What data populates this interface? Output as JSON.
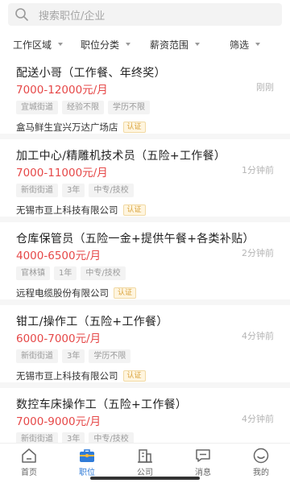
{
  "search": {
    "placeholder": "搜索职位/企业"
  },
  "filters": [
    {
      "label": "工作区域"
    },
    {
      "label": "职位分类"
    },
    {
      "label": "薪资范围"
    },
    {
      "label": "筛选"
    }
  ],
  "jobs": [
    {
      "title": "配送小哥（工作餐、年终奖）",
      "salary": "7000-12000元/月",
      "time": "刚刚",
      "tags": [
        "宜城街道",
        "经验不限",
        "学历不限"
      ],
      "company": "盒马鲜生宜兴万达广场店",
      "badge": "认证"
    },
    {
      "title": "加工中心/精雕机技术员（五险+工作餐）",
      "salary": "7000-11000元/月",
      "time": "1分钟前",
      "tags": [
        "新街街道",
        "3年",
        "中专/技校"
      ],
      "company": "无锡市亘上科技有限公司",
      "badge": "认证"
    },
    {
      "title": "仓库保管员（五险一金+提供午餐+各类补贴）",
      "salary": "4000-6500元/月",
      "time": "2分钟前",
      "tags": [
        "官林镇",
        "1年",
        "中专/技校"
      ],
      "company": "远程电缆股份有限公司",
      "badge": "认证"
    },
    {
      "title": "钳工/操作工（五险+工作餐）",
      "salary": "6000-7000元/月",
      "time": "4分钟前",
      "tags": [
        "新街街道",
        "3年",
        "学历不限"
      ],
      "company": "无锡市亘上科技有限公司",
      "badge": "认证"
    },
    {
      "title": "数控车床操作工（五险+工作餐）",
      "salary": "7000-9000元/月",
      "time": "4分钟前",
      "tags": [
        "新街街道",
        "3年",
        "中专/技校"
      ],
      "company": "",
      "badge": ""
    }
  ],
  "tabbar": [
    {
      "label": "首页",
      "icon": "home-icon"
    },
    {
      "label": "职位",
      "icon": "briefcase-icon",
      "active": true
    },
    {
      "label": "公司",
      "icon": "building-icon"
    },
    {
      "label": "消息",
      "icon": "message-icon"
    },
    {
      "label": "我的",
      "icon": "smile-icon"
    }
  ],
  "colors": {
    "accent": "#2f7bd8",
    "salary": "#e64848",
    "badge": "#d8a23b"
  }
}
